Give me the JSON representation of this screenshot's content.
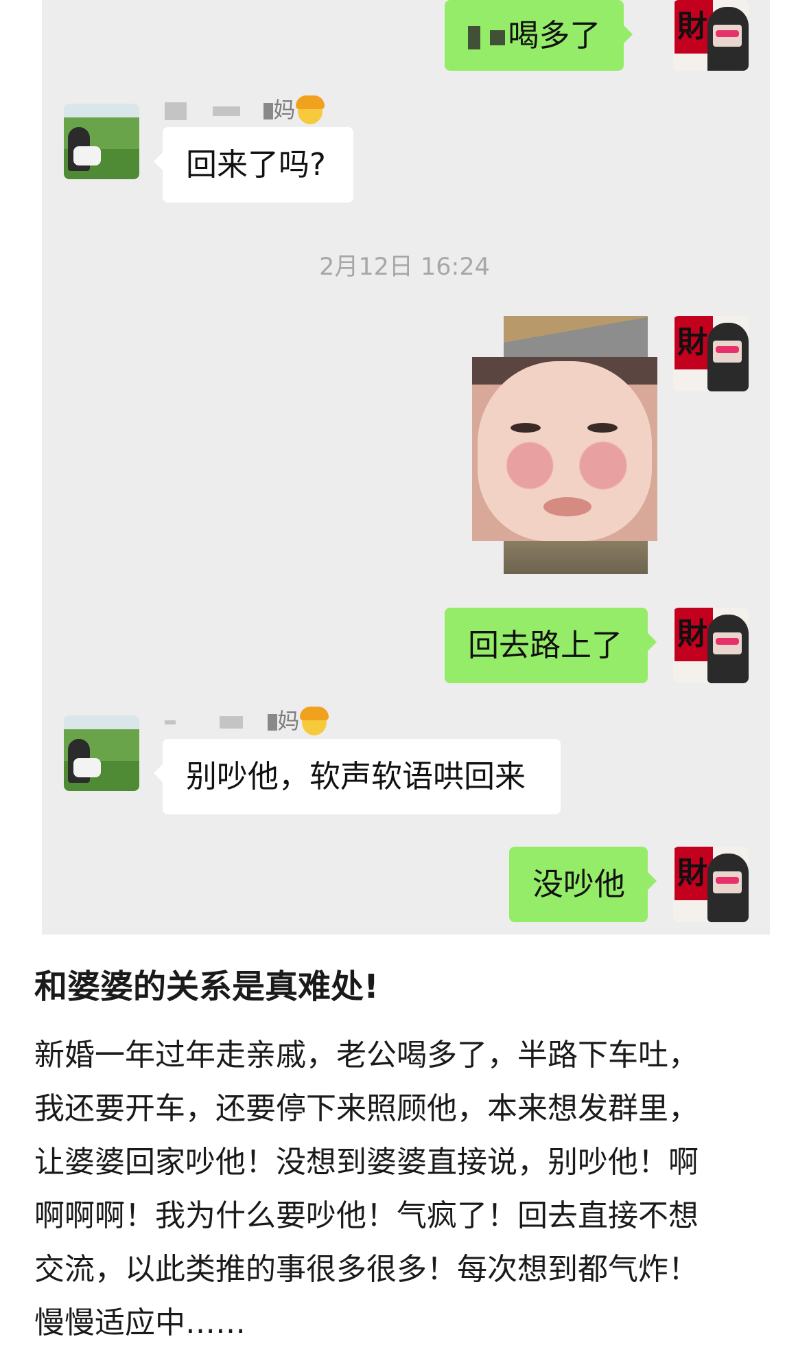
{
  "messages": {
    "m1_text": "喝多了",
    "m2_sender_suffix": "妈",
    "m2_text": "回来了吗?",
    "timestamp": "2月12日 16:24",
    "m4_text": "回去路上了",
    "m5_sender_suffix": "妈",
    "m5_text": "别吵他，软声软语哄回来",
    "m6_text": "没吵他"
  },
  "post": {
    "title": "和婆婆的关系是真难处!",
    "lines": [
      "新婚一年过年走亲戚，老公喝多了，半路下车吐，",
      "我还要开车，还要停下来照顾他，本来想发群里，",
      "让婆婆回家吵他！没想到婆婆直接说，别吵他！啊",
      "啊啊啊！我为什么要吵他！气疯了！回去直接不想",
      "交流，以此类推的事很多很多！每次想到都气炸！",
      "慢慢适应中……"
    ]
  },
  "icons": {
    "self_avatar": "avatar-red-fortune-card",
    "other_avatar": "avatar-tea-field-girl",
    "sender_emoji": "woman-emoji-icon",
    "sticker": "crying-baby-sticker"
  },
  "colors": {
    "chat_background": "#ededed",
    "my_bubble": "#95ec69",
    "their_bubble": "#ffffff",
    "timestamp_text": "#a7a7a7"
  }
}
